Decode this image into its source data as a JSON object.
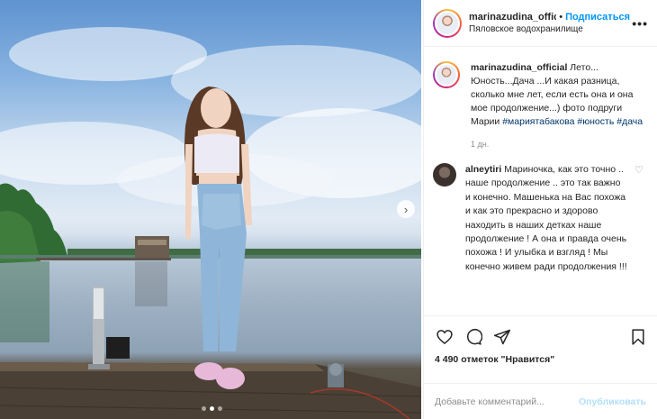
{
  "post": {
    "username": "marinazudina_offici",
    "follow_label": "Подписаться",
    "location": "Пяловское водохранилище",
    "separator": "•",
    "more_label": "•••"
  },
  "caption": {
    "username": "marinazudina_official",
    "text": "Лето... Юность...Дача ...И какая разница, сколько мне лет, если есть она и она мое продолжение...) фото подруги Марии",
    "hashtags": [
      "#мариятабакова",
      "#юность",
      "#дача"
    ],
    "time": "1 дн."
  },
  "comment": {
    "username": "alneytiri",
    "text": "Мариночка, как это точно .. наше продолжение .. это так важно и конечно. Машенька на Вас похожа и как это прекрасно и здорово находить в наших детках наше продолжение ! А она и правда очень похожа ! И улыбка и взгляд ! Мы конечно живем ради продолжения !!!"
  },
  "actions": {
    "likes_text": "4 490 отметок \"Нравится\"",
    "icons": [
      "heart-icon",
      "comment-icon",
      "share-icon",
      "bookmark-icon"
    ]
  },
  "add_comment": {
    "placeholder": "Добавьте комментарий...",
    "publish_label": "Опубликовать"
  },
  "carousel": {
    "dots": 3,
    "active_dot": 1,
    "next_glyph": "›"
  },
  "colors": {
    "link_blue": "#0095f6",
    "hashtag": "#00376b",
    "muted": "#8e8e8e",
    "publish_disabled": "#b2dffc"
  }
}
